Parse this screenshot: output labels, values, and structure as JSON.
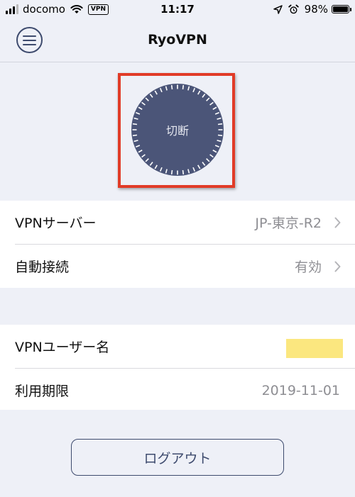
{
  "status_bar": {
    "carrier": "docomo",
    "vpn_badge": "VPN",
    "time": "11:17",
    "battery": "98%"
  },
  "nav": {
    "title": "RyoVPN"
  },
  "connect": {
    "label": "切断"
  },
  "settings": {
    "server_label": "VPNサーバー",
    "server_value": "JP-東京-R2",
    "autoconnect_label": "自動接続",
    "autoconnect_value": "有効"
  },
  "account": {
    "username_label": "VPNユーザー名",
    "expiry_label": "利用期限",
    "expiry_value": "2019-11-01"
  },
  "logout": {
    "label": "ログアウト"
  },
  "colors": {
    "accent": "#3e4b6e",
    "button_fill": "#4b5578",
    "highlight": "#e13b27",
    "background": "#eef0f7",
    "masked_username": "#fbe77f"
  }
}
